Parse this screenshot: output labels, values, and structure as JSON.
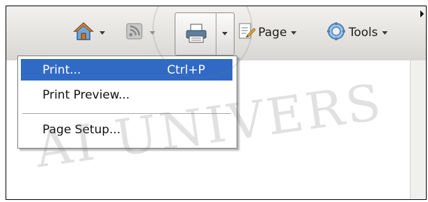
{
  "toolbar": {
    "page_label": "Page",
    "tools_label": "Tools"
  },
  "menu": {
    "items": [
      {
        "label": "Print...",
        "shortcut": "Ctrl+P",
        "selected": true
      },
      {
        "label": "Print Preview...",
        "shortcut": "",
        "selected": false
      },
      {
        "label": "Page Setup...",
        "shortcut": "",
        "selected": false
      }
    ]
  },
  "watermark": {
    "text": "AI UNIVERS"
  },
  "colors": {
    "menu_highlight": "#316ac5",
    "toolbar_bg": "#e3e2df"
  },
  "icons": [
    "home-icon",
    "feeds-icon",
    "printer-icon",
    "page-icon",
    "gear-icon"
  ]
}
